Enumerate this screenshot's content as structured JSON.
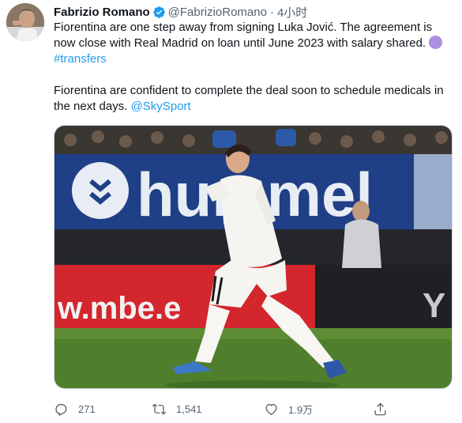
{
  "tweet": {
    "author_name": "Fabrizio Romano",
    "handle": "@FabrizioRomano",
    "separator": "·",
    "time": "4小时",
    "line1": "Fiorentina are one step away from signing Luka Jović. The agreement is now close with Real Madrid on loan until June 2023 with salary shared.",
    "hashtag": "#transfers",
    "line2": "Fiorentina are confident to complete the deal soon to schedule medicals in the next days.",
    "mention": "@SkySport"
  },
  "media": {
    "banner_top": "hummel",
    "banner_bottom": "w.mbe.e",
    "banner_right": "Y"
  },
  "actions": {
    "replies": "271",
    "retweets": "1,541",
    "likes": "1.9万"
  },
  "colors": {
    "link": "#1d9bf0",
    "verified": "#1d9bf0",
    "secondary_text": "#536471"
  }
}
